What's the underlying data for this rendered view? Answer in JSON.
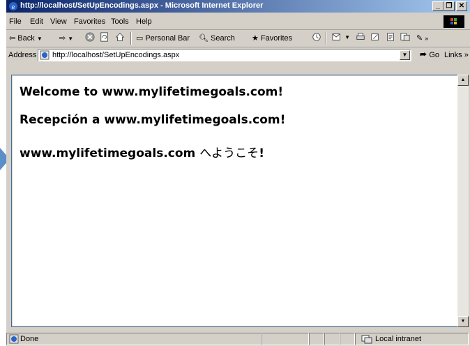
{
  "window": {
    "title": "http://localhost/SetUpEncodings.aspx - Microsoft Internet Explorer",
    "controls": [
      "_",
      "❐",
      "✕"
    ]
  },
  "menu": [
    "File",
    "Edit",
    "View",
    "Favorites",
    "Tools",
    "Help"
  ],
  "toolbar": {
    "back": "Back",
    "personal_bar": "Personal Bar",
    "search": "Search",
    "favorites": "Favorites"
  },
  "address": {
    "label": "Address",
    "url": "http://localhost/SetUpEncodings.aspx",
    "go": "Go",
    "links": "Links »"
  },
  "content": {
    "line1": "Welcome to www.mylifetimegoals.com!",
    "line2": "Recepción a www.mylifetimegoals.com!",
    "line3_site": "www.mylifetimegoals.com",
    "line3_jp": "へようこそ",
    "line3_end": "!"
  },
  "status": {
    "text": "Done",
    "zone": "Local intranet"
  },
  "colors": {
    "title_gradient_start": "#0a246a",
    "title_gradient_end": "#a6caf0",
    "chrome": "#d4d0c8",
    "callout": "#5b8fc7"
  }
}
